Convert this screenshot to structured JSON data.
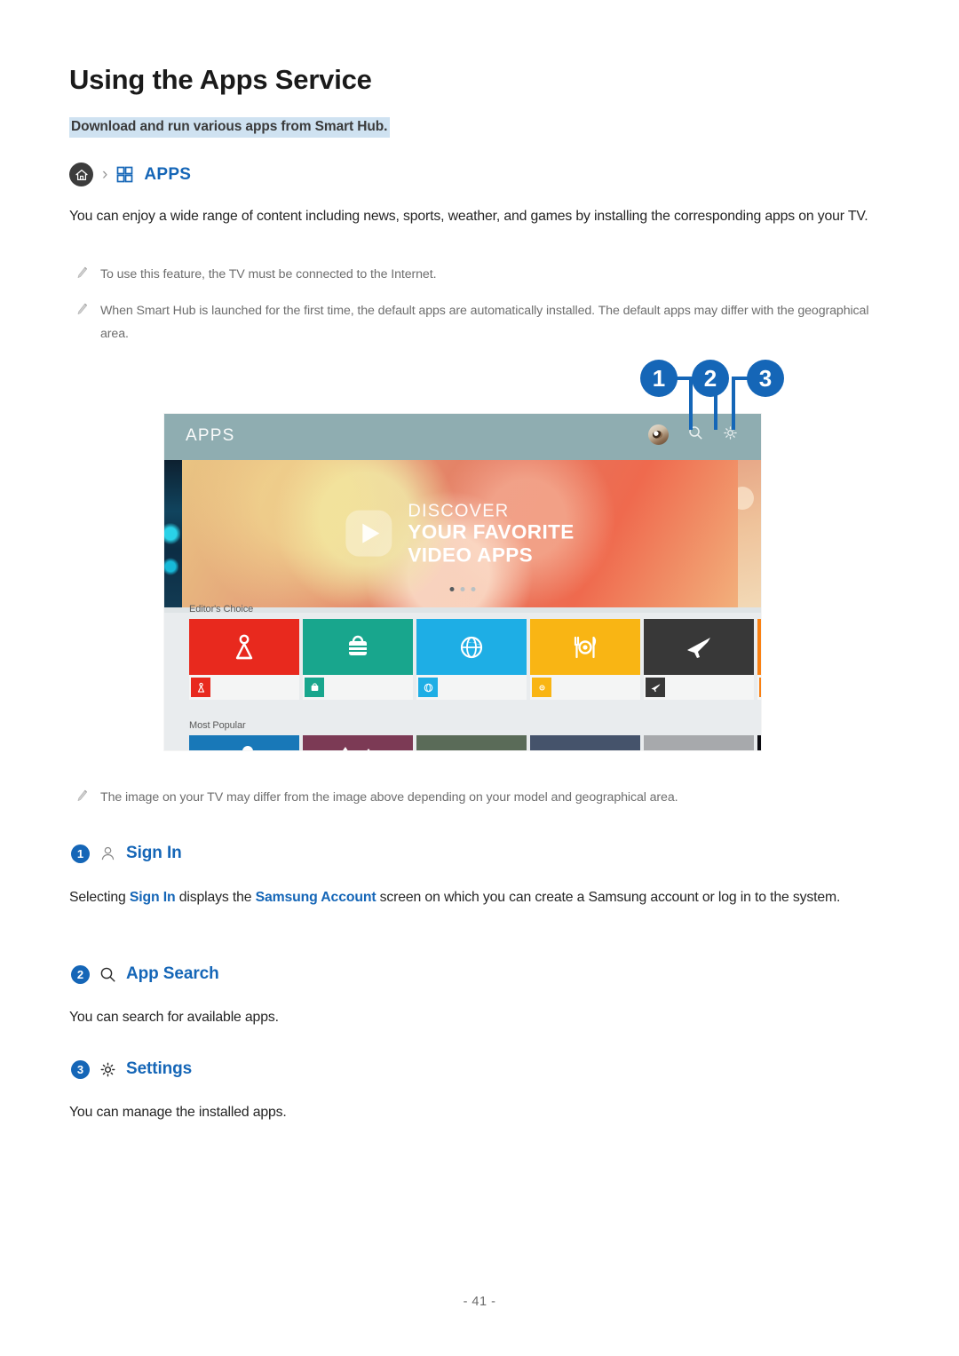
{
  "document": {
    "title": "Using the Apps Service",
    "subtitle": "Download and run various apps from Smart Hub.",
    "page_number": "- 41 -"
  },
  "breadcrumb": {
    "home_icon": "home-icon",
    "separator": "›",
    "grid_icon": "apps-grid-icon",
    "label": "APPS"
  },
  "intro": {
    "paragraph": "You can enjoy a wide range of content including news, sports, weather, and games by installing the corresponding apps on your TV."
  },
  "notes": [
    {
      "icon": "pencil-icon",
      "text": "To use this feature, the TV must be connected to the Internet."
    },
    {
      "icon": "pencil-icon",
      "text": "When Smart Hub is launched for the first time, the default apps are automatically installed. The default apps may differ with the geographical area."
    },
    {
      "icon": "pencil-icon",
      "text": "The image on your TV may differ from the image above depending on your model and geographical area."
    }
  ],
  "callouts": [
    {
      "number": "1",
      "target": "profile-avatar-icon"
    },
    {
      "number": "2",
      "target": "search-icon"
    },
    {
      "number": "3",
      "target": "settings-gear-icon"
    }
  ],
  "screenshot": {
    "header_label": "APPS",
    "header_icons": [
      "profile-avatar-icon",
      "search-icon",
      "settings-gear-icon"
    ],
    "banner": {
      "line1": "DISCOVER",
      "line2": "YOUR FAVORITE",
      "line3": "VIDEO APPS",
      "play_icon": "play-button-icon"
    },
    "carousel_dots": {
      "count": 3,
      "active_index": 0
    },
    "rows": [
      {
        "label": "Editor's Choice",
        "tiles": [
          {
            "icon": "map-person-icon",
            "color": "#e8291e"
          },
          {
            "icon": "suitcase-icon",
            "color": "#18a68d"
          },
          {
            "icon": "globe-icon",
            "color": "#1eaee5"
          },
          {
            "icon": "dining-icon",
            "color": "#f9b514"
          },
          {
            "icon": "airplane-icon",
            "color": "#383838"
          },
          {
            "icon": "bus-icon",
            "color": "#f98012"
          }
        ]
      },
      {
        "label": "Most Popular",
        "tiles": [
          {
            "color": "#1878b8"
          },
          {
            "color": "#7c3a55"
          },
          {
            "color": "#5a6b58"
          },
          {
            "color": "#45536b"
          },
          {
            "color": "#a7a9ac"
          },
          {
            "color": "#0b0b10"
          }
        ]
      }
    ]
  },
  "sections": [
    {
      "number": "1",
      "icon": "person-icon",
      "title": "Sign In",
      "body_before": "Selecting ",
      "link1": "Sign In",
      "body_mid": " displays the ",
      "link2": "Samsung Account",
      "body_after": " screen on which you can create a Samsung account or log in to the system."
    },
    {
      "number": "2",
      "icon": "search-icon",
      "title": "App Search",
      "body": "You can search for available apps."
    },
    {
      "number": "3",
      "icon": "settings-gear-icon",
      "title": "Settings",
      "body": "You can manage the installed apps."
    }
  ],
  "colors": {
    "accent_blue": "#1566b7",
    "highlight": "#cfe2f1",
    "note_gray": "#6e6e6e"
  }
}
